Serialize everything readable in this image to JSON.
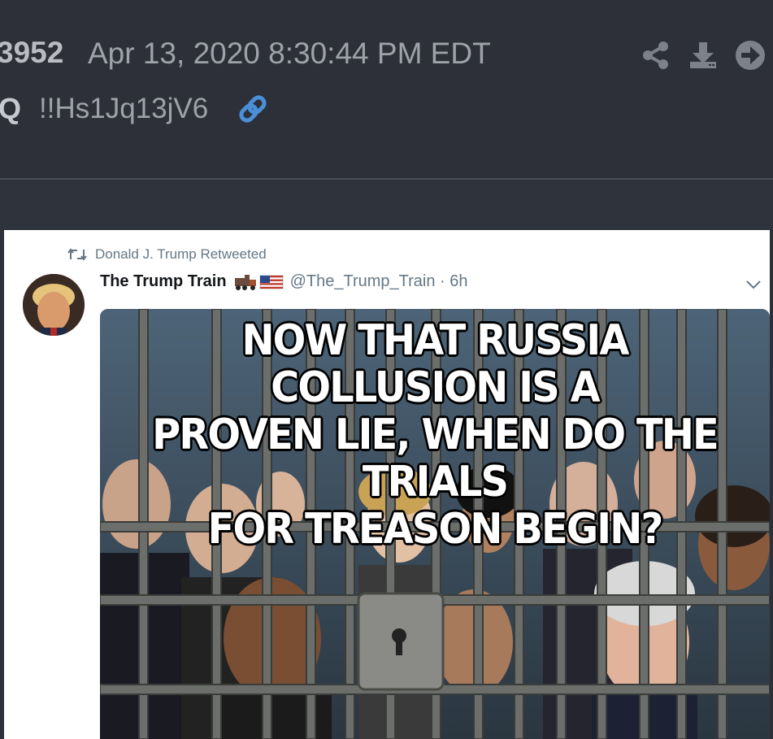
{
  "post": {
    "number": "3952",
    "datetime": "Apr 13, 2020 8:30:44 PM EDT",
    "author": "Q",
    "tripcode": "!!Hs1Jq13jV6",
    "icons": [
      "share-icon",
      "download-icon",
      "arrow-right-circle-icon",
      "link-icon"
    ]
  },
  "tweet": {
    "retweet_label": "Donald J. Trump Retweeted",
    "display_name": "The Trump Train",
    "handle_time": "@The_Trump_Train · 6h",
    "meme_lines": [
      "NOW THAT RUSSIA COLLUSION IS A",
      "PROVEN LIE, WHEN DO THE TRIALS",
      "FOR TREASON BEGIN?"
    ]
  },
  "colors": {
    "background": "#2d3038",
    "link_icon": "#4a90d9",
    "tweet_bg": "#ffffff"
  }
}
